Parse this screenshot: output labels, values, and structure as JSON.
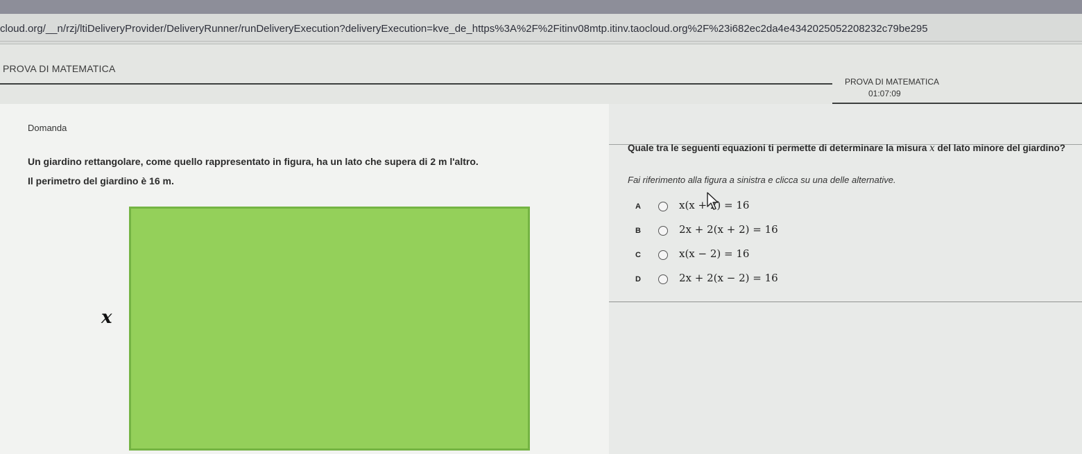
{
  "browser": {
    "url": "cloud.org/__n/rzj/ltiDeliveryProvider/DeliveryRunner/runDeliveryExecution?deliveryExecution=kve_de_https%3A%2F%2Fitinv08mtp.itinv.taocloud.org%2F%23i682ec2da4e4342025052208232c79be295"
  },
  "header": {
    "test_title_left": "PROVA DI MATEMATICA",
    "test_title_right": "PROVA DI MATEMATICA",
    "timer": "01:07:09"
  },
  "left": {
    "section_label": "Domanda",
    "problem_text": "Un giardino rettangolare, come quello rappresentato in figura, ha un lato che supera di 2 m l'altro.",
    "perimeter_text": "Il perimetro del giardino è 16 m.",
    "figure": {
      "side_label": "x",
      "fill_color": "#94d05a",
      "border_color": "#74b443"
    }
  },
  "right": {
    "question_before": "Quale tra le seguenti equazioni ti permette di determinare la misura ",
    "question_var": "x",
    "question_after": " del lato minore del giardino?",
    "instruction": "Fai riferimento alla figura a sinistra e clicca su una delle alternative.",
    "options": [
      {
        "letter": "A",
        "formula": "x(x + 2) = 16"
      },
      {
        "letter": "B",
        "formula": "2x + 2(x + 2) = 16"
      },
      {
        "letter": "C",
        "formula": "x(x − 2) = 16"
      },
      {
        "letter": "D",
        "formula": "2x + 2(x − 2) = 16"
      }
    ]
  }
}
